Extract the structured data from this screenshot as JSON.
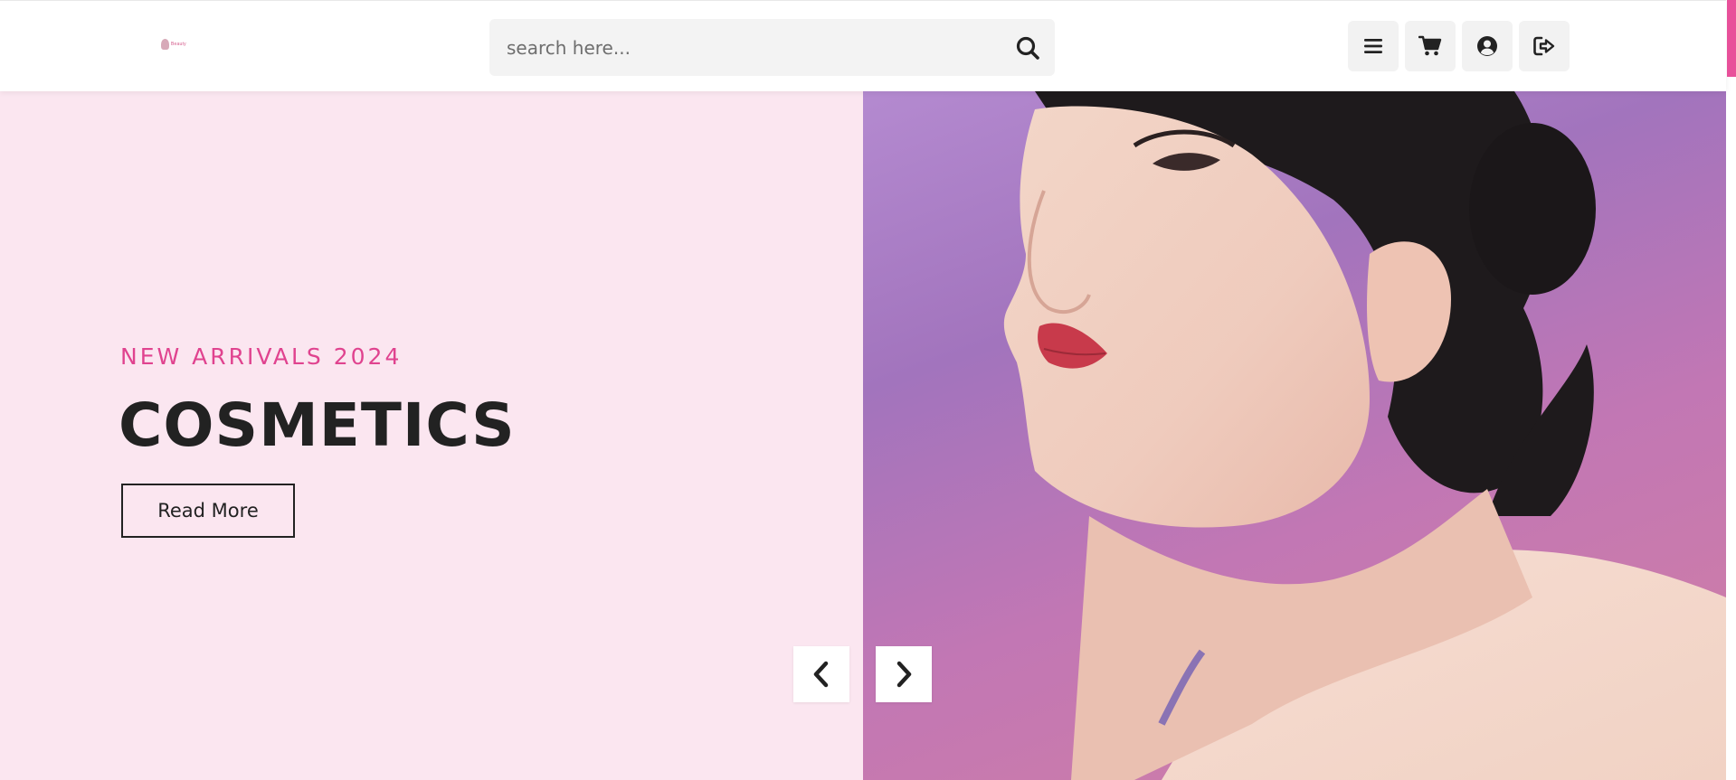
{
  "brand": {
    "logo_text": "Beauty",
    "accent_color": "#e0438f"
  },
  "header": {
    "search": {
      "placeholder": "search here..."
    },
    "icons": [
      "menu-icon",
      "cart-icon",
      "user-icon",
      "logout-icon"
    ]
  },
  "hero": {
    "eyebrow": "NEW ARRIVALS 2024",
    "title": "COSMETICS",
    "cta_label": "Read More",
    "background_color": "#fbe6f0",
    "image_description_icon": "model-portrait-image"
  },
  "carousel": {
    "prev_icon": "chevron-left-icon",
    "next_icon": "chevron-right-icon"
  }
}
